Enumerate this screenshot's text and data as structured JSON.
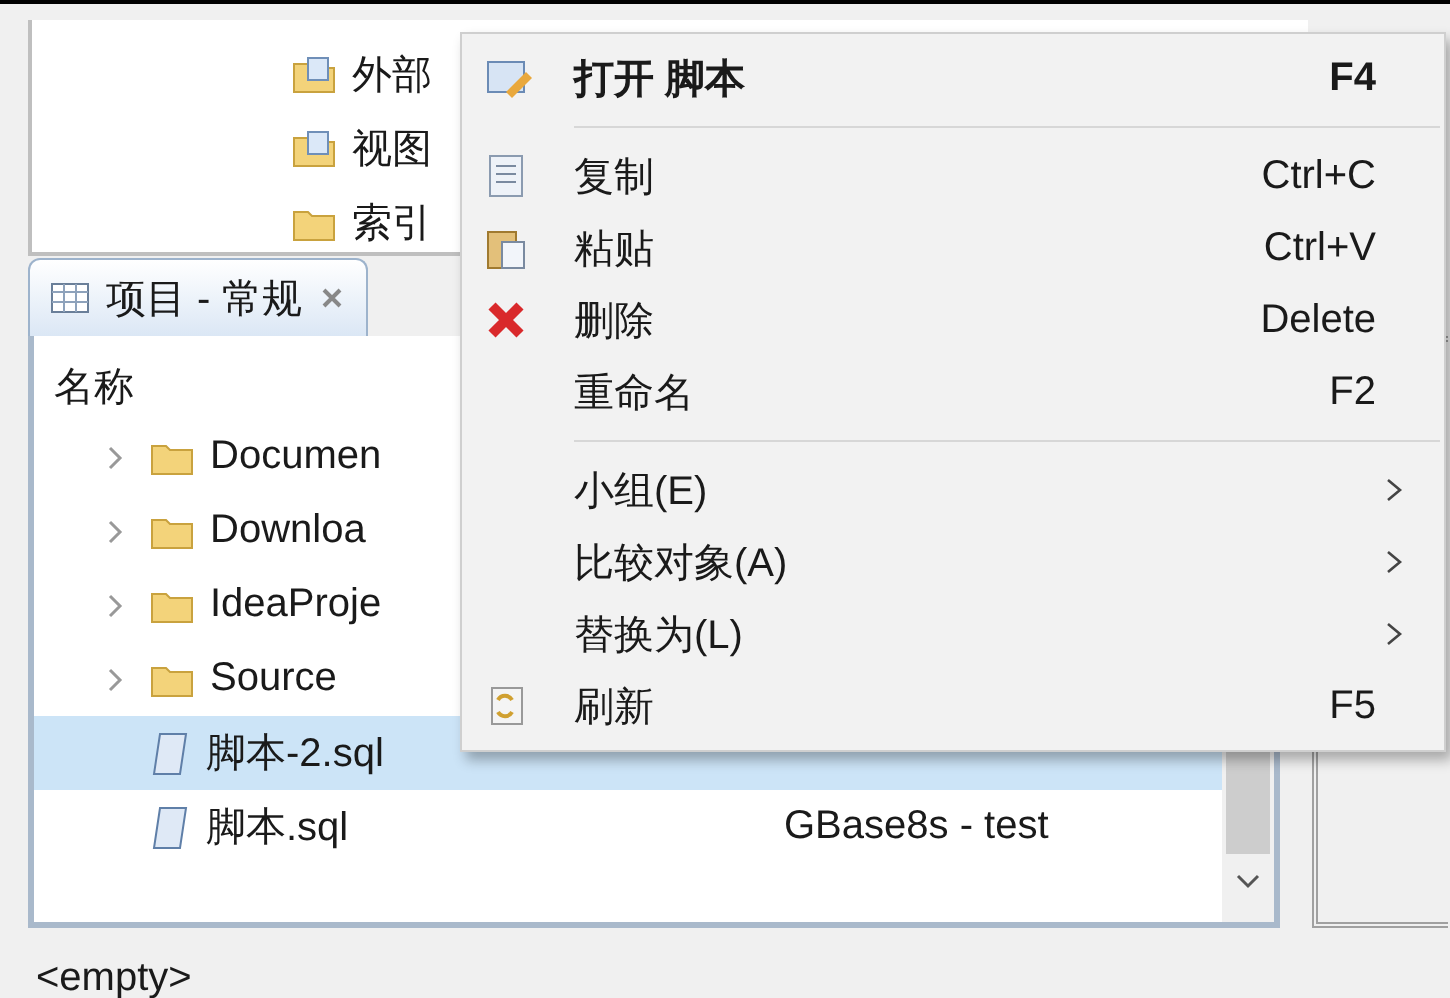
{
  "top_panel": {
    "items": [
      "外部",
      "视图",
      "索引"
    ]
  },
  "tab": {
    "label": "项目 - 常规",
    "selected": true
  },
  "tree": {
    "column_1": "名称",
    "rows": [
      {
        "kind": "folder",
        "name": "Documen",
        "expanded": false,
        "selected": false
      },
      {
        "kind": "folder",
        "name": "Downloa",
        "expanded": false,
        "selected": false
      },
      {
        "kind": "folder",
        "name": "IdeaProje",
        "expanded": false,
        "selected": false
      },
      {
        "kind": "folder",
        "name": "Source",
        "expanded": false,
        "selected": false
      },
      {
        "kind": "file",
        "name": "脚本-2.sql",
        "selected": true
      },
      {
        "kind": "file",
        "name": "脚本.sql",
        "connection": "GBase8s - test",
        "selected": false
      }
    ]
  },
  "status": "<empty>",
  "context_menu": [
    {
      "kind": "item",
      "label": "打开 脚本",
      "shortcut": "F4",
      "default": true
    },
    {
      "kind": "separator"
    },
    {
      "kind": "item",
      "label": "复制",
      "shortcut": "Ctrl+C",
      "default": false
    },
    {
      "kind": "item",
      "label": "粘贴",
      "shortcut": "Ctrl+V",
      "default": false
    },
    {
      "kind": "item",
      "label": "删除",
      "shortcut": "Delete",
      "default": false
    },
    {
      "kind": "item",
      "label": "重命名",
      "shortcut": "F2",
      "default": false
    },
    {
      "kind": "separator"
    },
    {
      "kind": "submenu",
      "label": "小组(E)"
    },
    {
      "kind": "submenu",
      "label": "比较对象(A)"
    },
    {
      "kind": "submenu",
      "label": "替换为(L)"
    },
    {
      "kind": "item",
      "label": "刷新",
      "shortcut": "F5",
      "default": false
    }
  ]
}
